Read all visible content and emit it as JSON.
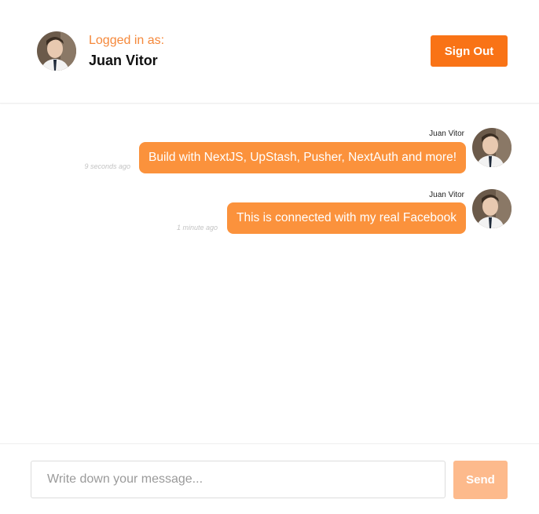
{
  "header": {
    "logged_label": "Logged in as:",
    "user_name": "Juan Vitor",
    "sign_out_label": "Sign Out"
  },
  "messages": [
    {
      "sender": "Juan Vitor",
      "text": "Build with NextJS, UpStash, Pusher, NextAuth and more!",
      "time": "9 seconds ago"
    },
    {
      "sender": "Juan Vitor",
      "text": "This is connected with my real Facebook",
      "time": "1 minute ago"
    }
  ],
  "composer": {
    "placeholder": "Write down your message...",
    "value": "",
    "send_label": "Send"
  },
  "colors": {
    "accent": "#f97316",
    "bubble": "#fb923c",
    "send_disabled": "#fdba8c"
  },
  "icons": {
    "avatar": "user-avatar-photo"
  }
}
